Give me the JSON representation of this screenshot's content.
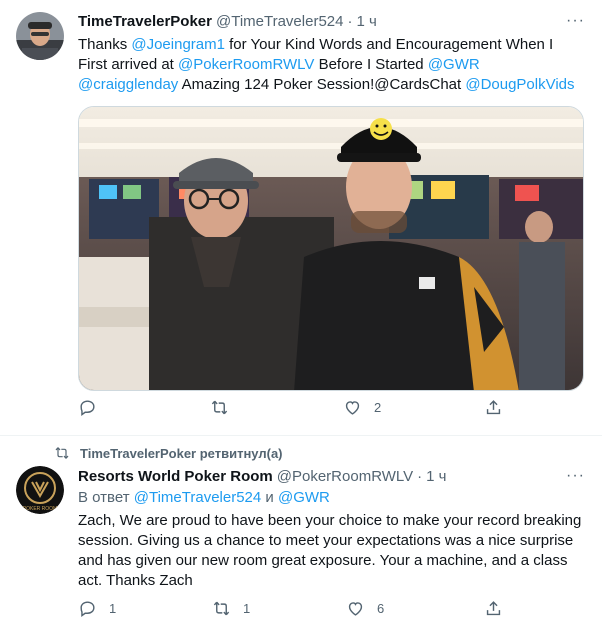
{
  "tweet1": {
    "name": "TimeTravelerPoker",
    "handle": "@TimeTraveler524",
    "separator": "·",
    "time": "1 ч",
    "more": "···",
    "text": {
      "p1": "Thanks ",
      "m1": "@Joeingram1",
      "p2": " for Your Kind Words and Encouragement When I First arrived at ",
      "m2": "@PokerRoomRWLV",
      "p3": "  Before I Started ",
      "m3": "@GWR",
      "p4": " ",
      "m4": "@craigglenday",
      "p5": " Amazing 124 Poker Session!@CardsChat ",
      "m5": "@DougPolkVids"
    },
    "hat_logo": "PH",
    "actions": {
      "reply_count": "",
      "retweet_count": "",
      "like_count": "2"
    }
  },
  "retweet_banner": "TimeTravelerPoker ретвитнул(а)",
  "tweet2": {
    "name": "Resorts World Poker Room",
    "handle": "@PokerRoomRWLV",
    "separator": "·",
    "time": "1 ч",
    "more": "···",
    "avatar_text": "POKER ROOM",
    "reply_to": {
      "prefix": "В ответ ",
      "user1": "@TimeTraveler524",
      "and": " и ",
      "user2": "@GWR"
    },
    "text": "Zach, We are proud to have been your choice to make your record breaking session. Giving us a chance to meet your expectations was a nice surprise and has given our new room great exposure. Your a machine, and a class act. Thanks Zach",
    "actions": {
      "reply_count": "1",
      "retweet_count": "1",
      "like_count": "6"
    }
  },
  "colors": {
    "link": "#1d9bf0",
    "muted": "#536471",
    "text": "#0f1419"
  },
  "icons": [
    "reply-icon",
    "retweet-icon",
    "like-icon",
    "share-icon",
    "more-icon"
  ]
}
